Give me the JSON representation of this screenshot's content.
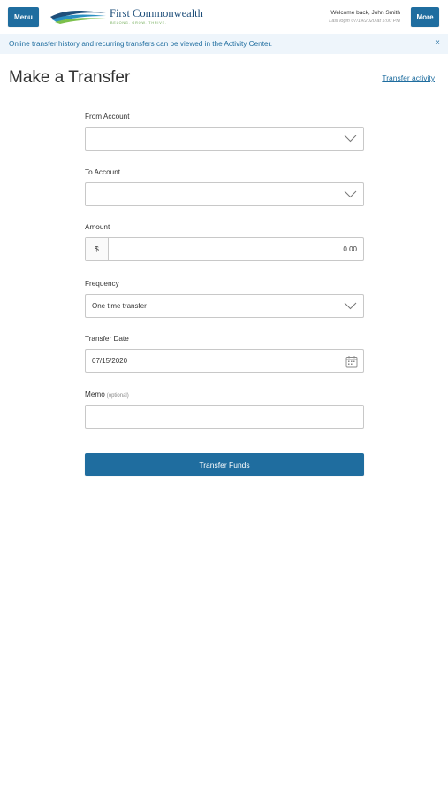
{
  "header": {
    "menu_label": "Menu",
    "more_label": "More",
    "brand_name": "First Commonwealth",
    "brand_tagline": "BELONG. GROW. THRIVE.",
    "welcome_text": "Welcome back, John Smith",
    "last_login_text": "Last login 07/14/2020 at 5:00 PM",
    "accent_color": "#1f6d9f"
  },
  "banner": {
    "message": "Online transfer history and recurring transfers can be viewed in the Activity Center.",
    "close_glyph": "×"
  },
  "page": {
    "title": "Make a Transfer",
    "activity_link": "Transfer activity"
  },
  "form": {
    "from_account": {
      "label": "From Account",
      "value": ""
    },
    "to_account": {
      "label": "To Account",
      "value": ""
    },
    "amount": {
      "label": "Amount",
      "currency": "$",
      "value": "0.00"
    },
    "frequency": {
      "label": "Frequency",
      "value": "One time transfer"
    },
    "transfer_date": {
      "label": "Transfer Date",
      "value": "07/15/2020"
    },
    "memo": {
      "label": "Memo",
      "optional_note": "(optional)",
      "value": ""
    },
    "submit_label": "Transfer Funds"
  },
  "icons": {
    "dropdown": "chevron-down-icon",
    "calendar": "calendar-icon",
    "close": "close-icon"
  }
}
